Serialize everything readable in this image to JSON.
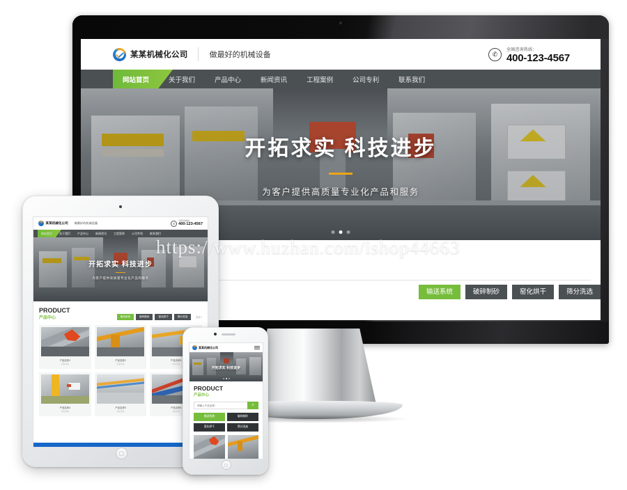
{
  "page": {
    "watermark": "https://www.huzhan.com/ishop44663",
    "background": "#ffffff"
  },
  "colors": {
    "accent_green": "#76bd3c",
    "nav_dark": "#4b5053",
    "hero_rule_orange": "#f0a515",
    "tablet_footer_blue": "#1667c8",
    "logo_blue": "#2f86d8",
    "logo_orange": "#e8a020"
  },
  "site": {
    "header": {
      "logo_text": "某某机械化公司",
      "slogan": "做最好的机械设备",
      "phone_label": "全国咨询热线：",
      "phone_number": "400-123-4567",
      "phone_icon": "phone-icon"
    },
    "nav": {
      "items": [
        {
          "label": "网站首页",
          "active": true
        },
        {
          "label": "关于我们",
          "active": false
        },
        {
          "label": "产品中心",
          "active": false
        },
        {
          "label": "新闻资讯",
          "active": false
        },
        {
          "label": "工程案例",
          "active": false
        },
        {
          "label": "公司专利",
          "active": false
        },
        {
          "label": "联系我们",
          "active": false
        }
      ]
    },
    "hero": {
      "title": "开拓求实 科技进步",
      "subtitle": "为客户提供高质量专业化产品和服务",
      "slides": 3,
      "active_slide": 1
    },
    "product": {
      "title_en": "PRODUCT",
      "title_cn": "产品中心",
      "more_label": "更多+",
      "categories": [
        {
          "label": "输送系统",
          "active": true
        },
        {
          "label": "破碎制砂",
          "active": false
        },
        {
          "label": "窑化烘干",
          "active": false
        },
        {
          "label": "筛分洗选",
          "active": false
        }
      ],
      "items": [
        {
          "name": "产品名称1",
          "sub": "查看详情"
        },
        {
          "name": "产品名称2",
          "sub": "查看详情"
        },
        {
          "name": "产品名称3",
          "sub": "查看详情"
        },
        {
          "name": "产品名称4",
          "sub": "查看详情"
        },
        {
          "name": "产品名称5",
          "sub": "查看详情"
        },
        {
          "name": "产品名称6",
          "sub": "查看详情"
        }
      ]
    },
    "mobile": {
      "search_placeholder": "请输入产品名称...",
      "search_icon": "search-icon",
      "menu_icon": "hamburger-icon",
      "quick_categories": [
        {
          "label": "输送系统",
          "active": true
        },
        {
          "label": "破碎制砂",
          "active": false
        },
        {
          "label": "窑化烘干",
          "active": false
        },
        {
          "label": "筛分洗选",
          "active": false
        }
      ]
    }
  },
  "devices": {
    "desktop": {
      "name": "imac-monitor"
    },
    "tablet": {
      "name": "ipad-tablet"
    },
    "phone": {
      "name": "iphone-mobile"
    }
  }
}
